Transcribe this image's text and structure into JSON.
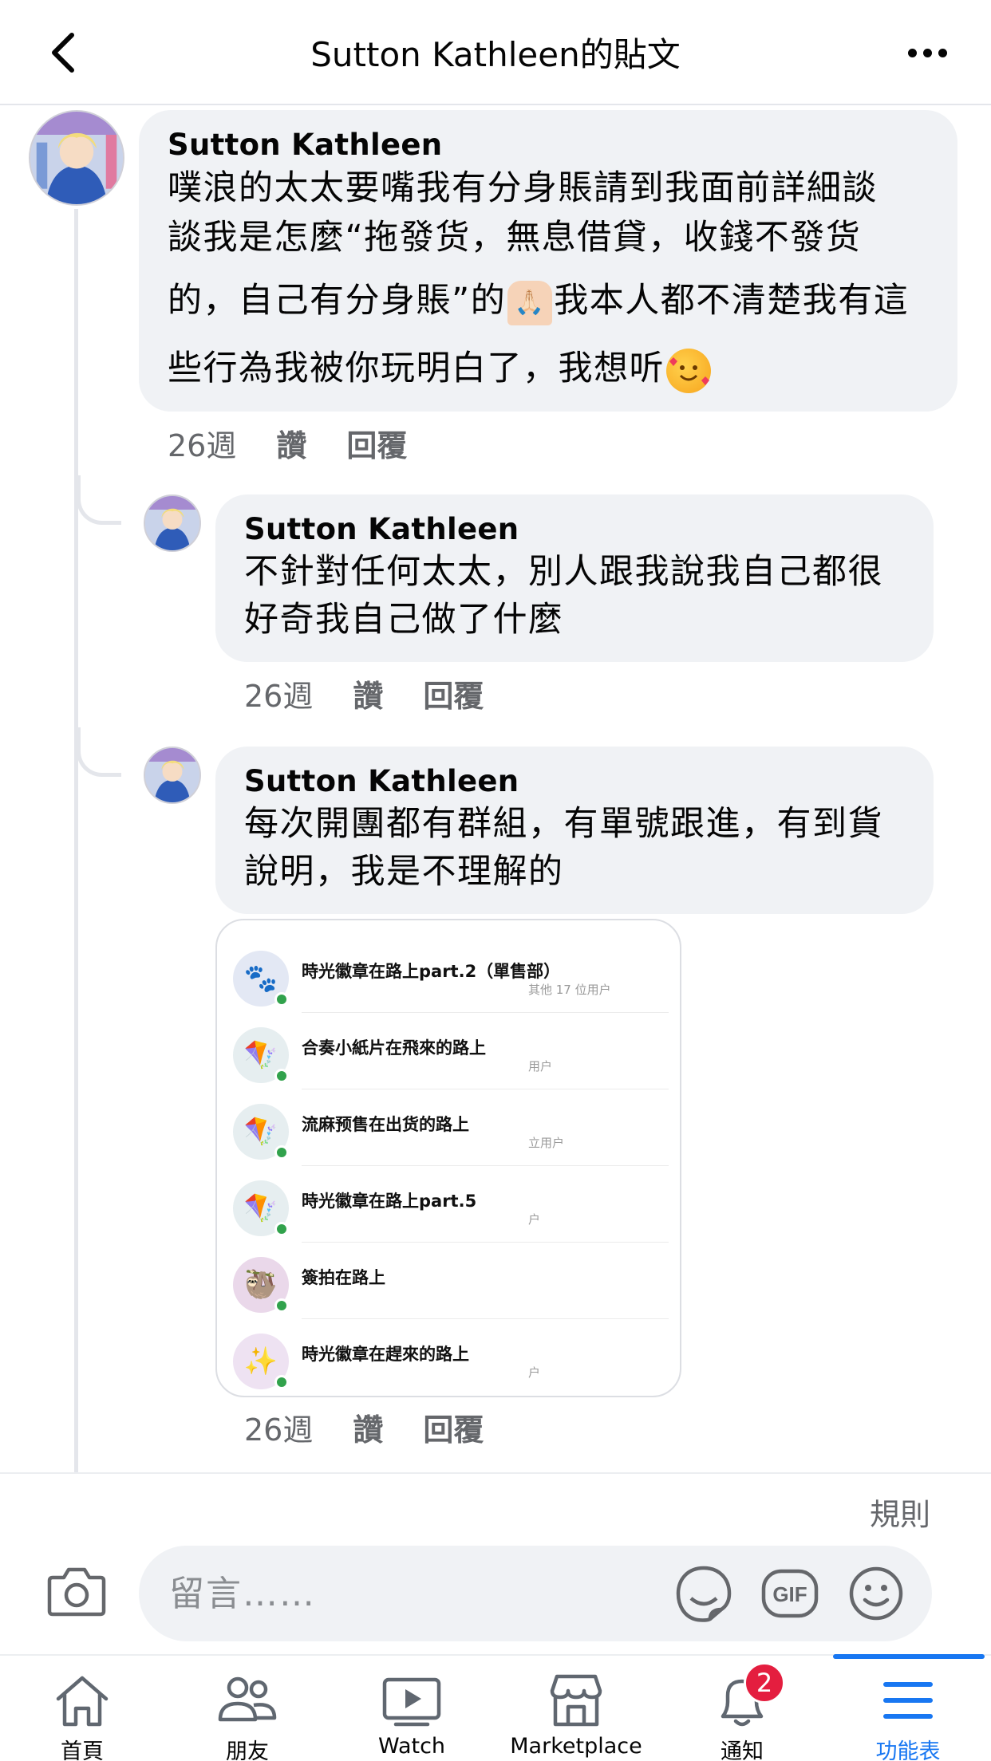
{
  "header": {
    "title": "Sutton Kathleen的貼文"
  },
  "comments": [
    {
      "author": "Sutton Kathleen",
      "text_lines": [
        "噗浪的太太要嘴我有分身賬請到我面前詳細談",
        "談我是怎麼“拖發货，無息借貸，收錢不發货",
        "的，自己有分身賬”的",
        "我本人都不清楚我有這",
        "些行為我被你玩明白了，我想听"
      ],
      "emoji_hands": "🙏🏻",
      "emoji_face": "🥰",
      "time": "26週",
      "like_label": "讚",
      "reply_label": "回覆"
    },
    {
      "author": "Sutton Kathleen",
      "text_lines": [
        "不針對任何太太，別人跟我說我自己都很",
        "好奇我自己做了什麼"
      ],
      "time": "26週",
      "like_label": "讚",
      "reply_label": "回覆"
    },
    {
      "author": "Sutton Kathleen",
      "text_lines": [
        "每次開團都有群組，有單號跟進，有到貨",
        "說明，我是不理解的"
      ],
      "time": "26週",
      "like_label": "讚",
      "reply_label": "回覆",
      "image": {
        "groups": [
          {
            "name": "時光徽章在路上part.2（單售部）",
            "sub": "其他 17 位用户",
            "icon": "paw-icon",
            "bg": "#e3e8f4",
            "glyph": "🐾"
          },
          {
            "name": "合奏小紙片在飛來的路上",
            "sub": "用户",
            "icon": "kite-icon",
            "bg": "#e6eef0",
            "glyph": "🪁"
          },
          {
            "name": "流麻预售在出货的路上",
            "sub": "立用户",
            "icon": "kite-icon",
            "bg": "#e6eef0",
            "glyph": "🪁"
          },
          {
            "name": "時光徽章在路上part.5",
            "sub": "户",
            "icon": "kite-icon",
            "bg": "#e6eef0",
            "glyph": "🪁"
          },
          {
            "name": "簽拍在路上",
            "sub": "",
            "icon": "sloth-icon",
            "bg": "#ead8ea",
            "glyph": "🦥"
          },
          {
            "name": "時光徽章在趕來的路上",
            "sub": "户",
            "icon": "sparkles-icon",
            "bg": "#eee2f2",
            "glyph": "✨"
          }
        ]
      }
    }
  ],
  "composer": {
    "rules_label": "規則",
    "placeholder": "留言……"
  },
  "nav": {
    "items": [
      {
        "label": "首頁",
        "icon": "home-icon"
      },
      {
        "label": "朋友",
        "icon": "friends-icon"
      },
      {
        "label": "Watch",
        "icon": "watch-icon"
      },
      {
        "label": "Marketplace",
        "icon": "marketplace-icon"
      },
      {
        "label": "通知",
        "icon": "bell-icon",
        "badge": "2"
      },
      {
        "label": "功能表",
        "icon": "menu-icon",
        "active": true
      }
    ]
  },
  "colors": {
    "accent": "#1877f2",
    "bubble": "#f0f2f5",
    "muted_text": "#65676b",
    "badge": "#e41e3f"
  }
}
